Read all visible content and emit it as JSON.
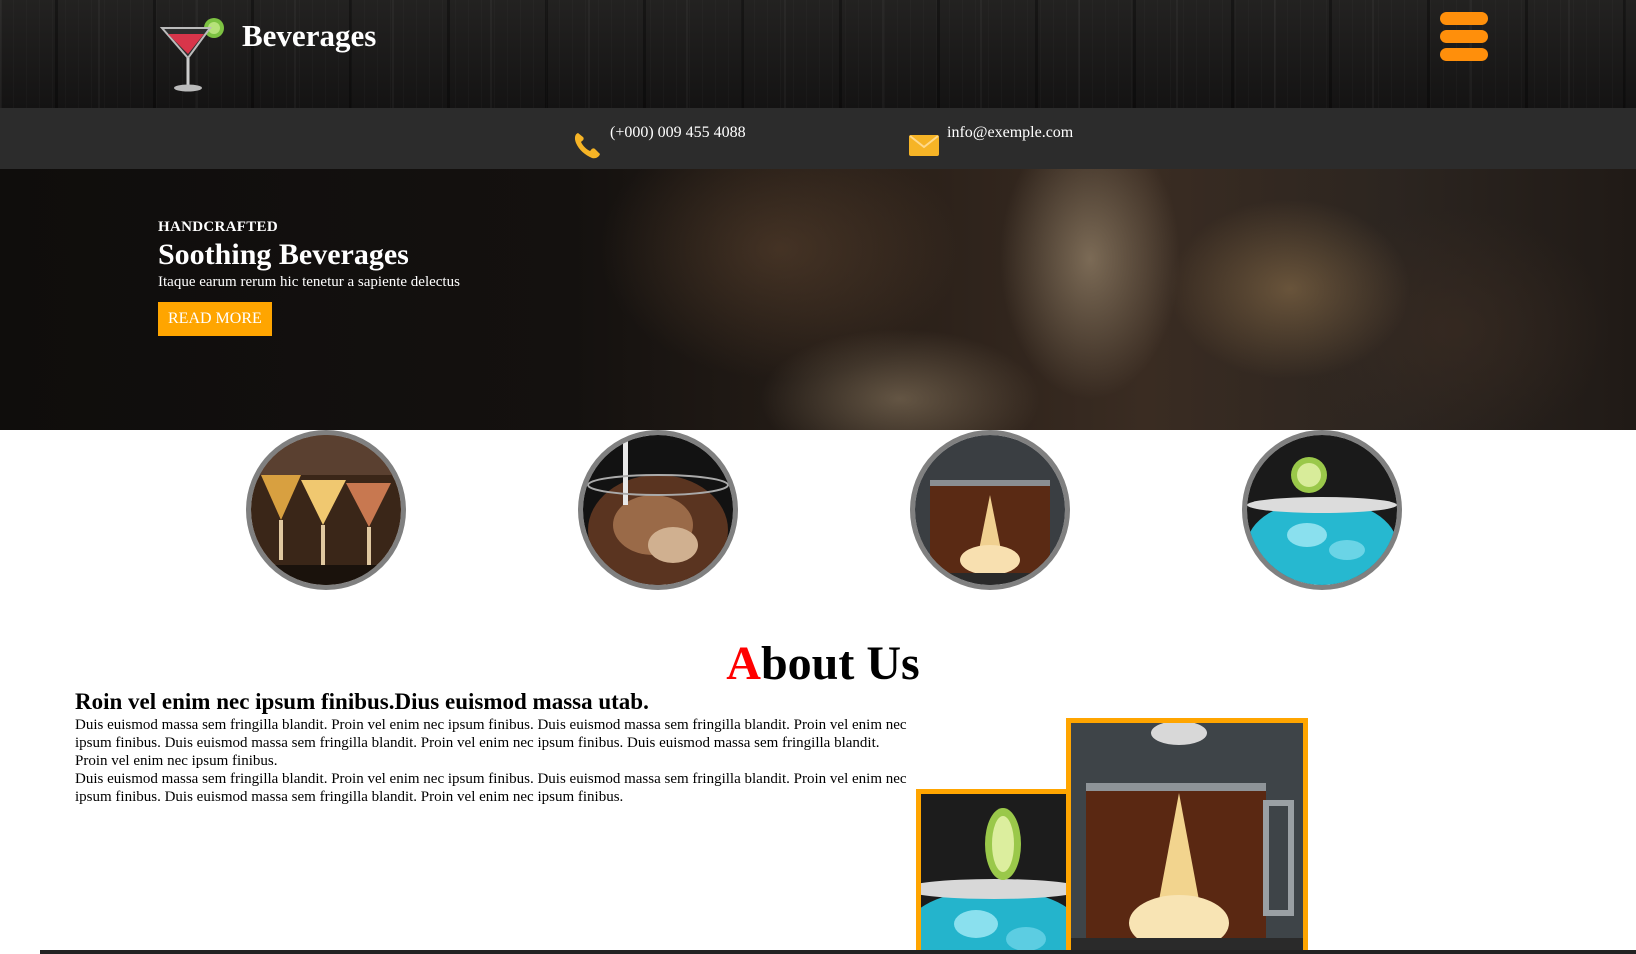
{
  "header": {
    "brand": "Beverages",
    "logo_icon": "cocktail-glass-icon",
    "menu_icon": "hamburger-menu-icon",
    "accent_color": "#ff8f0b"
  },
  "contact": {
    "phone": "(+000) 009 455 4088",
    "phone_icon": "phone-icon",
    "email": "info@exemple.com",
    "email_icon": "envelope-icon"
  },
  "hero": {
    "kicker": "HANDCRAFTED",
    "title": "Soothing Beverages",
    "subtitle": "Itaque earum rerum hic tenetur a sapiente delectus",
    "button_label": "READ MORE",
    "button_color": "#ffa500"
  },
  "gallery": {
    "items": [
      {
        "name": "cocktail-glasses-image"
      },
      {
        "name": "iced-coffee-image"
      },
      {
        "name": "tea-mug-image"
      },
      {
        "name": "blue-cocktail-image"
      }
    ]
  },
  "about": {
    "title_first": "A",
    "title_rest": "bout Us",
    "title_accent": "#ff0000",
    "subtitle": "Roin vel enim nec ipsum finibus.Dius euismod massa utab.",
    "paragraph_1": "Duis euismod massa sem fringilla blandit. Proin vel enim nec ipsum finibus. Duis euismod massa sem fringilla blandit. Proin vel enim nec ipsum finibus. Duis euismod massa sem fringilla blandit. Proin vel enim nec ipsum finibus. Duis euismod massa sem fringilla blandit. Proin vel enim nec ipsum finibus.",
    "paragraph_2": "Duis euismod massa sem fringilla blandit. Proin vel enim nec ipsum finibus. Duis euismod massa sem fringilla blandit. Proin vel enim nec ipsum finibus. Duis euismod massa sem fringilla blandit. Proin vel enim nec ipsum finibus.",
    "frame_color": "#ffa500"
  }
}
